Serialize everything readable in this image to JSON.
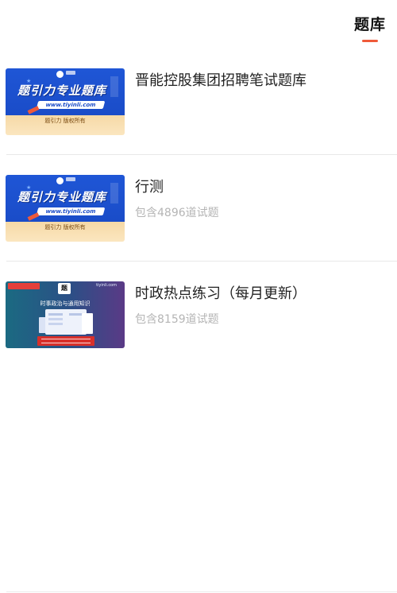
{
  "header": {
    "active_tab": "题库"
  },
  "banners": {
    "blue": {
      "headline": "题引力专业题库",
      "url": "www.tiyinli.com",
      "rights": "题引力 版权所有"
    },
    "dark": {
      "tag": "",
      "site": "tiyinli.com",
      "logo": "题",
      "subtitle": "时事政治与通用知识"
    }
  },
  "items": [
    {
      "title": "晋能控股集团招聘笔试题库",
      "count": ""
    },
    {
      "title": "行测",
      "count": "包含4896道试题"
    },
    {
      "title": "时政热点练习（每月更新）",
      "count": "包含8159道试题"
    }
  ],
  "colors": {
    "accent": "#ef5a3a",
    "title_text": "#222222",
    "count_text": "#b5b5b5"
  }
}
